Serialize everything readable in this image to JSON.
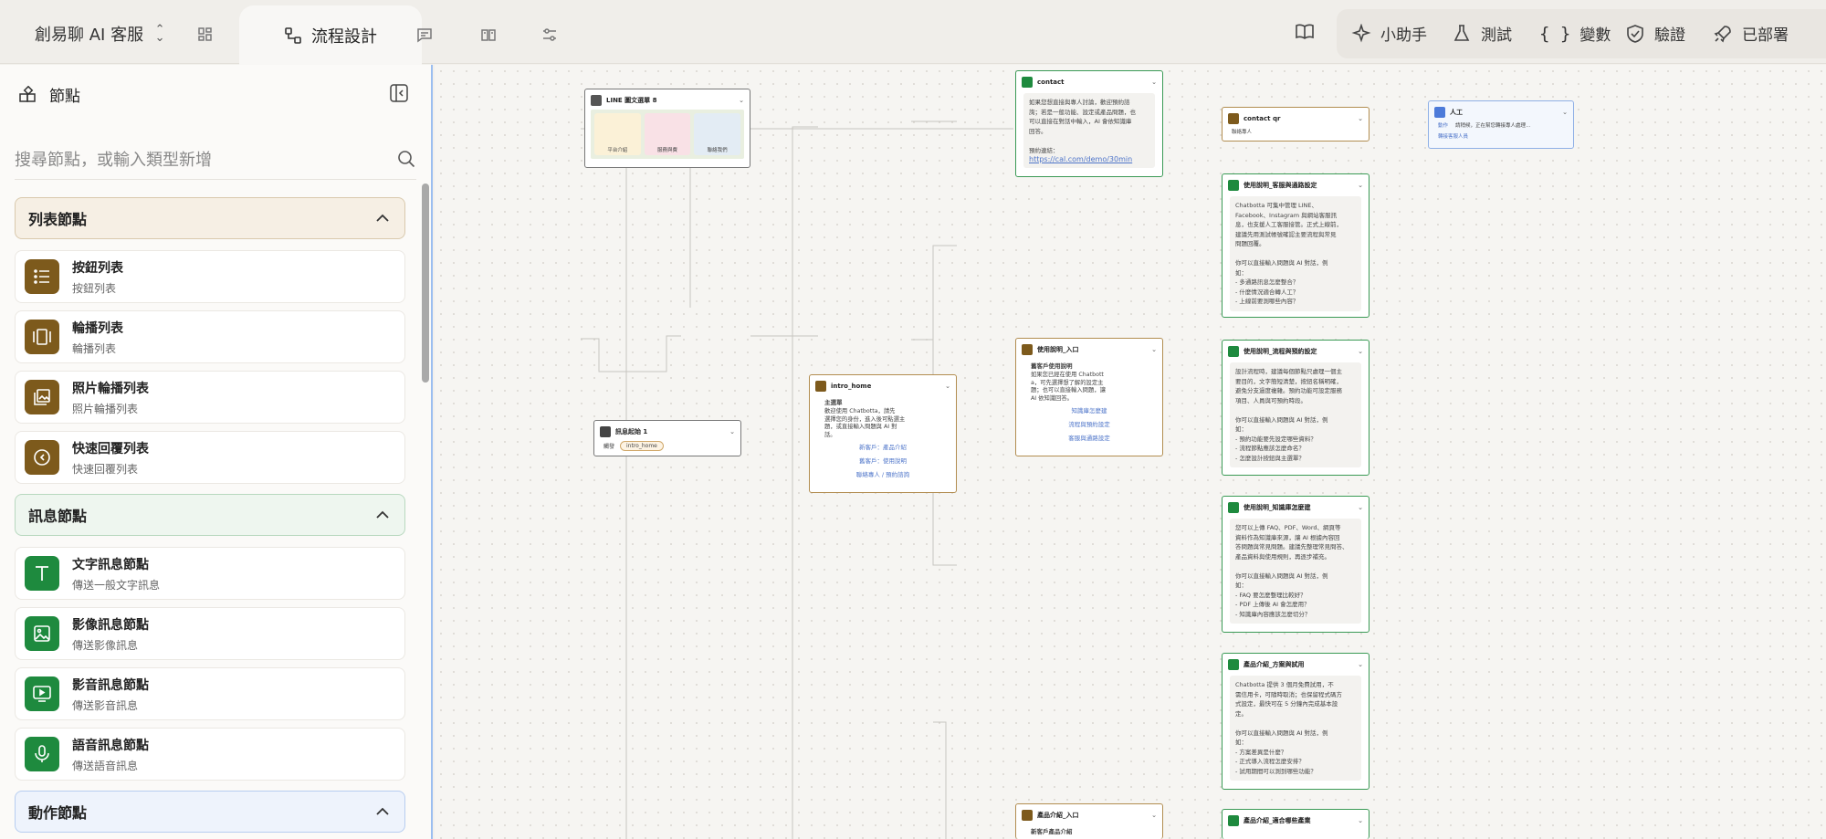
{
  "topbar": {
    "app_title": "創易聊 AI 客服",
    "active_tab": "流程設計",
    "icons": [
      "grid-icon",
      "flow-icon",
      "chat-icon",
      "book-open-icon",
      "sliders-icon"
    ],
    "actions": [
      {
        "icon": "book-icon",
        "label": ""
      },
      {
        "icon": "sparkle-icon",
        "label": "小助手"
      },
      {
        "icon": "flask-icon",
        "label": "測試"
      },
      {
        "icon": "braces-icon",
        "label": "變數"
      },
      {
        "icon": "shield-check-icon",
        "label": "驗證"
      },
      {
        "icon": "rocket-icon",
        "label": "已部署"
      }
    ]
  },
  "sidebar": {
    "title": "節點",
    "search_placeholder": "搜尋節點，或輸入類型新增",
    "sections": [
      {
        "label": "列表節點",
        "color": "#7d5a1c"
      },
      {
        "label": "訊息節點",
        "color": "#1e8a3e"
      },
      {
        "label": "動作節點",
        "color": "#4c7ad9"
      }
    ],
    "list_items": [
      {
        "title": "按鈕列表",
        "sub": "按鈕列表"
      },
      {
        "title": "輪播列表",
        "sub": "輪播列表"
      },
      {
        "title": "照片輪播列表",
        "sub": "照片輪播列表"
      },
      {
        "title": "快速回覆列表",
        "sub": "快速回覆列表"
      }
    ],
    "message_items": [
      {
        "title": "文字訊息節點",
        "sub": "傳送一般文字訊息"
      },
      {
        "title": "影像訊息節點",
        "sub": "傳送影像訊息"
      },
      {
        "title": "影音訊息節點",
        "sub": "傳送影音訊息"
      },
      {
        "title": "語音訊息節點",
        "sub": "傳送語音訊息"
      }
    ]
  },
  "canvas": {
    "line_menu": {
      "title": "LINE 圖文選單 8",
      "cells": [
        "平台介紹",
        "服務與費",
        "聯絡我們"
      ]
    },
    "start": {
      "title": "訊息起始 1",
      "label": "觸發",
      "tag": "intro_home"
    },
    "intro_home": {
      "title": "intro_home",
      "heading": "主選單",
      "body": "歡迎使用 Chatbotta，請先\n選擇您的身份，進入後可點選主\n題，或直接輸入問題與 AI 對\n話。",
      "links": [
        "新客戶：產品介紹",
        "舊客戶：使用說明",
        "聯絡專人 / 預約諮詢"
      ]
    },
    "contact": {
      "title": "contact",
      "body": "如果您想直接與專人討論，歡迎預約諮\n詢；若是一般功能、設定或產品問題，也\n可以直接在對話中輸入，AI 會依知識庫\n回答。\n\n預約連結：",
      "link": "https://cal.com/demo/30min"
    },
    "contact_qr": {
      "title": "contact qr",
      "sub": "聯絡專人"
    },
    "human": {
      "title": "人工",
      "label": "動作",
      "text": "請稍候，正在幫您轉接專人處理...",
      "sub": "轉接客服人員"
    },
    "use_entry": {
      "title": "使用說明_入口",
      "heading": "舊客戶使用說明",
      "body": "如果您已經在使用 Chatbott\na，可先選擇想了解的設定主\n題；也可以直接輸入問題，讓\nAI 依知識回答。",
      "links": [
        "知識庫怎麼建",
        "流程與預約設定",
        "客服與通路設定"
      ]
    },
    "use_channels": {
      "title": "使用說明_客服與通路設定",
      "body": "Chatbotta 可集中管理 LINE、\nFacebook、Instagram 與網站客服訊\n息，也支援人工客服接管。正式上線前，\n建議先用測試帳號確認主要流程與常見\n問題回覆。\n\n你可以直接輸入問題與 AI 對話，例\n如：\n- 多通路訊息怎麼整合？\n- 什麼情況適合轉人工？\n- 上線前要測哪些內容？"
    },
    "use_flow": {
      "title": "使用說明_流程與預約設定",
      "body": "設計流程時，建議每個節點只處理一個主\n要目的，文字簡短清楚，按鈕名稱明確，\n避免分支過度複雜。預約功能可設定服務\n項目、人員與可預約時段。\n\n你可以直接輸入問題與 AI 對話，例\n如：\n- 預約功能要先設定哪些資料？\n- 流程節點應該怎麼命名？\n- 怎麼設計按鈕與主選單？"
    },
    "use_kb": {
      "title": "使用說明_知識庫怎麼建",
      "body": "您可以上傳 FAQ、PDF、Word、網頁等\n資料作為知識庫來源，讓 AI 根據內容回\n答問題與常見問題。建議先整理常見問答、\n產品資料與使用規則，再逐步補充。\n\n你可以直接輸入問題與 AI 對話，例\n如：\n- FAQ 要怎麼整理比較好？\n- PDF 上傳後 AI 會怎麼用？\n- 知識庫內容應該怎麼切分？"
    },
    "prod_plans": {
      "title": "產品介紹_方案與試用",
      "body": "Chatbotta 提供 3 個月免費試用，不\n需信用卡，可隨時取消；也保留程式碼方\n式設定，最快可在 5 分鐘內完成基本設\n定。\n\n你可以直接輸入問題與 AI 對話，例\n如：\n- 方案差異是什麼？\n- 正式導入流程怎麼安排？\n- 試用期間可以測到哪些功能？"
    },
    "prod_entry": {
      "title": "產品介紹_入口",
      "heading": "新客戶產品介紹"
    },
    "prod_fit": {
      "title": "產品介紹_適合哪些產業"
    }
  }
}
